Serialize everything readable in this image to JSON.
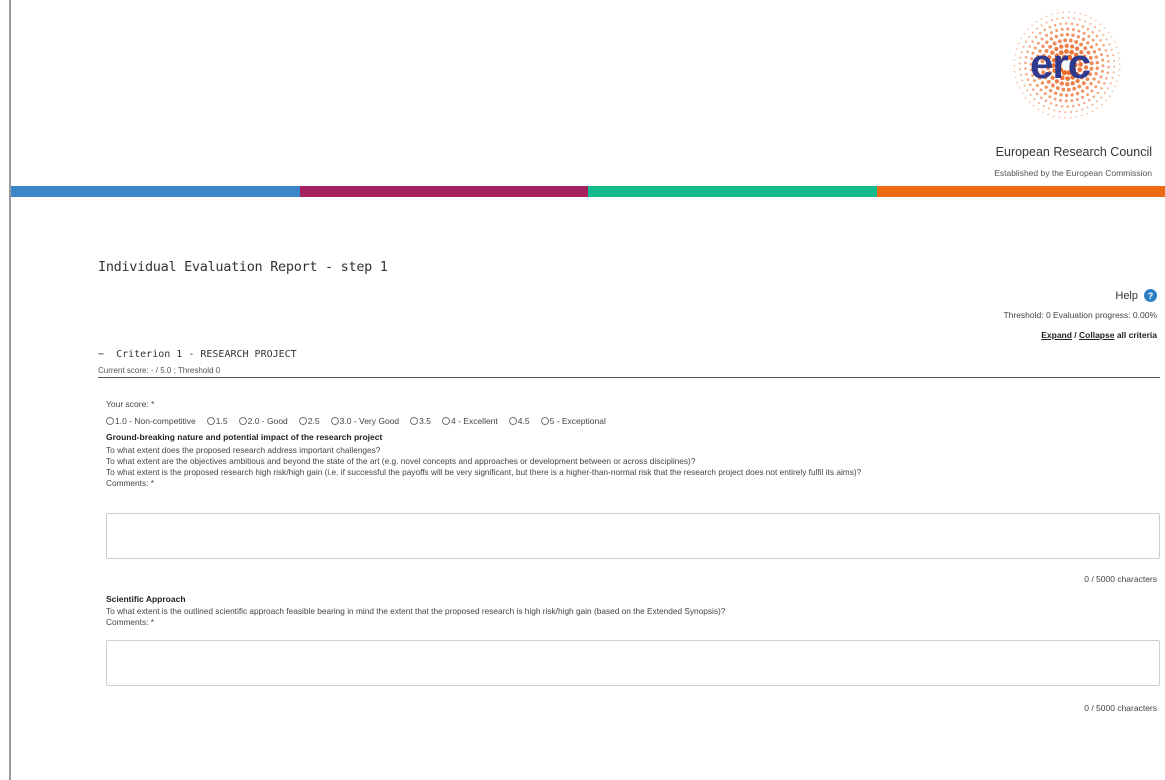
{
  "header": {
    "logo_text": "erc",
    "org_name": "European Research Council",
    "org_subtitle": "Established by the European Commission",
    "colors": {
      "logo_dots": "#ec6a2a",
      "logo_text": "#2f3a8f"
    },
    "bands": [
      "#3a86c8",
      "#a5215f",
      "#13bb8c",
      "#ee6b16"
    ]
  },
  "page": {
    "title": "Individual Evaluation Report - step 1",
    "help_label": "Help",
    "help_icon": "?",
    "progress_text": "Threshold: 0 Evaluation progress: 0.00%",
    "expand_label": "Expand",
    "separator": " / ",
    "collapse_label": "Collapse",
    "all_criteria": " all criteria"
  },
  "criterion": {
    "toggle": "−",
    "title": "Criterion 1 - RESEARCH PROJECT",
    "current_score": "Current score: - / 5.0 ; Threshold 0",
    "your_score_label": "Your score: *",
    "score_options": [
      "1.0 - Non-competitive",
      "1.5",
      "2.0 - Good",
      "2.5",
      "3.0 - Very Good",
      "3.5",
      "4 - Excellent",
      "4.5",
      "5 - Exceptional"
    ],
    "questions": [
      {
        "title": "Ground-breaking nature and potential impact of the research project",
        "lines": [
          "To what extent does the proposed research address important challenges?",
          "To what extent are the objectives ambitious and beyond the state of the art (e.g. novel concepts and approaches or development between or across disciplines)?",
          "To what extent is the proposed research high risk/high gain (i.e. if successful the payoffs will be very significant, but there is a higher-than-normal risk that the research project does not entirely fulfil its aims)?"
        ],
        "comments_label": "Comments: *",
        "comment_value": "",
        "char_count": "0 / 5000 characters"
      },
      {
        "title": "Scientific Approach",
        "lines": [
          "To what extent is the outlined scientific approach feasible bearing in mind the extent that the proposed research is high risk/high gain (based on the Extended Synopsis)?"
        ],
        "comments_label": "Comments: *",
        "comment_value": "",
        "char_count": "0 / 5000 characters"
      }
    ]
  }
}
